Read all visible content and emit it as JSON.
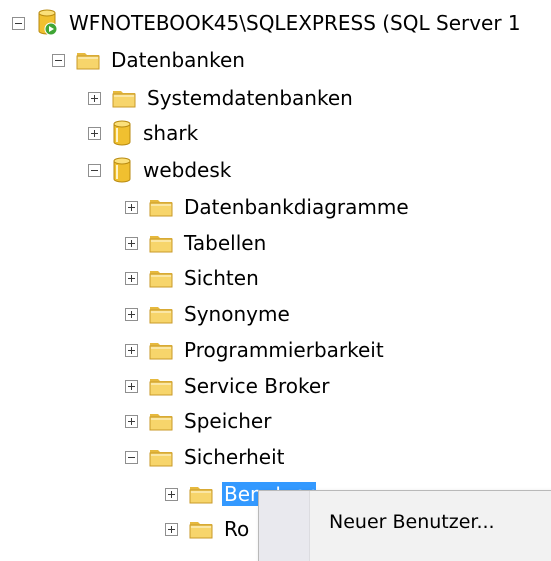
{
  "tree": {
    "server": "WFNOTEBOOK45\\SQLEXPRESS (SQL Server 1",
    "databases": "Datenbanken",
    "system_databases": "Systemdatenbanken",
    "db_shark": "shark",
    "db_webdesk": "webdesk",
    "webdesk_children": [
      "Datenbankdiagramme",
      "Tabellen",
      "Sichten",
      "Synonyme",
      "Programmierbarkeit",
      "Service Broker",
      "Speicher",
      "Sicherheit"
    ],
    "security_children": [
      "Benutzer",
      "Ro"
    ]
  },
  "context_menu": {
    "new_user": "Neuer Benutzer..."
  },
  "colors": {
    "selection": "#3399ff",
    "folder": "#f2cd5d",
    "database": "#f0c030",
    "server_badge": "#3fa535"
  },
  "icons": {
    "expander_expanded": "minus-box",
    "expander_collapsed": "plus-box",
    "folder": "folder-icon",
    "database": "database-cylinder-icon",
    "server": "server-icon"
  }
}
